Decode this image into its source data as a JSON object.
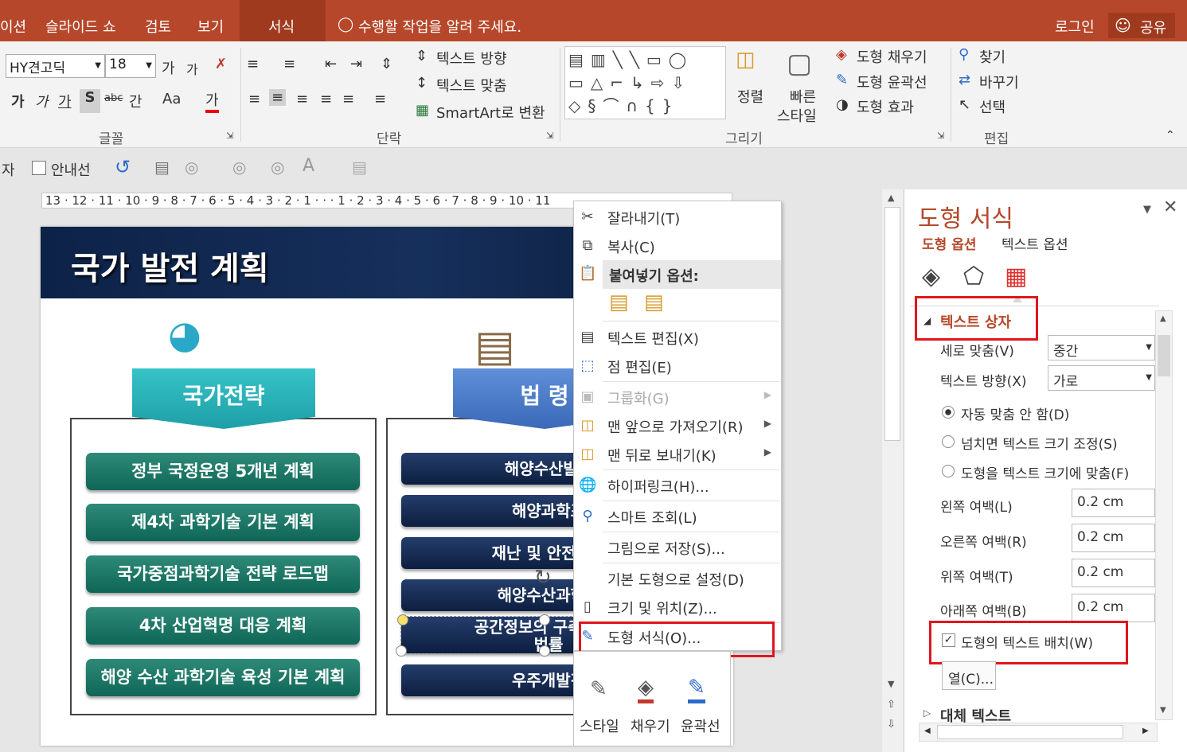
{
  "titlebar": {
    "tabs": [
      "이션",
      "슬라이드 쇼",
      "검토",
      "보기",
      "서식"
    ],
    "tell_me": "수행할 작업을 알려 주세요.",
    "login": "로그인",
    "share": "공유"
  },
  "ribbon": {
    "font_name": "HY견고딕",
    "font_size": "18",
    "grow": "가",
    "shrink": "가",
    "bold": "가",
    "italic": "가",
    "underline": "가",
    "shadow": "S",
    "strike": "abc",
    "spacing": "간",
    "case": "Aa",
    "fontcolor": "가",
    "group_font": "글꼴",
    "group_para": "단락",
    "text_dir": "텍스트 방향",
    "text_align": "텍스트 맞춤",
    "smartart": "SmartArt로 변환",
    "group_draw": "그리기",
    "arrange": "정렬",
    "quick_style_1": "빠른",
    "quick_style_2": "스타일",
    "shape_fill": "도형 채우기",
    "shape_outline": "도형 윤곽선",
    "shape_effect": "도형 효과",
    "find": "찾기",
    "replace": "바꾸기",
    "select": "선택",
    "group_edit": "편집"
  },
  "toolbar2": {
    "label_ja": "자",
    "guides": "안내선"
  },
  "ruler": "13 · 12 · 11 · 10 · 9 · 8 · 7 · 6 · 5 · 4 · 3 · 2 · 1 · · · 1 · 2 · 3 · 4 · 5 · 6 · 7 · 8 · 9 · 10 · 11",
  "slide": {
    "title": "국가 발전 계획",
    "col1_header": "국가전략",
    "col1_items": [
      "정부 국정운영 5개년 계획",
      "제4차 과학기술 기본 계획",
      "국가중점과학기술 전략 로드맵",
      "4차 산업혁명 대응 계획",
      "해양 수산 과학기술 육성 기본 계획"
    ],
    "col2_header": "법 령",
    "col2_items": [
      "해양수산발전",
      "해양과학조",
      "재난 및 안전관리",
      "해양수산과학기",
      "공간정보의 구축 및 관",
      "법률",
      "우주개발진"
    ]
  },
  "context_menu": {
    "cut": "잘라내기(T)",
    "copy": "복사(C)",
    "paste_options": "붙여넣기 옵션:",
    "edit_text": "텍스트 편집(X)",
    "edit_points": "점 편집(E)",
    "group": "그룹화(G)",
    "bring_front": "맨 앞으로 가져오기(R)",
    "send_back": "맨 뒤로 보내기(K)",
    "hyperlink": "하이퍼링크(H)...",
    "smart_lookup": "스마트 조회(L)",
    "save_picture": "그림으로 저장(S)...",
    "set_default": "기본 도형으로 설정(D)",
    "size_position": "크기 및 위치(Z)...",
    "format_shape": "도형 서식(O)..."
  },
  "mini_toolbar": {
    "style": "스타일",
    "fill": "채우기",
    "outline": "윤곽선"
  },
  "pane": {
    "title": "도형 서식",
    "tab_shape": "도형 옵션",
    "tab_text": "텍스트 옵션",
    "section": "텍스트 상자",
    "vertical_align_label": "세로 맞춤(V)",
    "vertical_align_value": "중간",
    "text_dir_label": "텍스트 방향(X)",
    "text_dir_value": "가로",
    "autofit_none": "자동 맞춤 안 함(D)",
    "autofit_shrink": "넘치면 텍스트 크기 조정(S)",
    "autofit_resize": "도형을 텍스트 크기에 맞춤(F)",
    "margin_left_label": "왼쪽 여백(L)",
    "margin_right_label": "오른쪽 여백(R)",
    "margin_top_label": "위쪽 여백(T)",
    "margin_bottom_label": "아래쪽 여백(B)",
    "margin_value": "0.2 cm",
    "wrap_label": "도형의 텍스트 배치(W)",
    "columns_button": "열(C)...",
    "alt_text": "대체 텍스트"
  },
  "colors": {
    "accent": "#b7472a",
    "highlight": "#e0161d"
  }
}
